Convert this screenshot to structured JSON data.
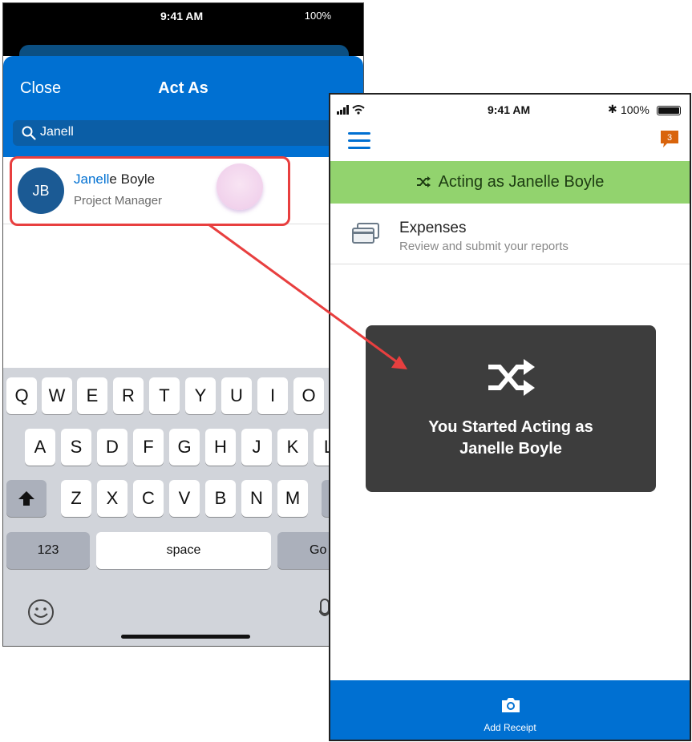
{
  "left_phone": {
    "status": {
      "time": "9:41 AM",
      "battery": "100%"
    },
    "header": {
      "close_label": "Close",
      "title": "Act As"
    },
    "search": {
      "query": "Janell"
    },
    "result": {
      "initials": "JB",
      "name_match": "Janell",
      "name_rest": "e Boyle",
      "role": "Project Manager"
    },
    "keyboard": {
      "row1": [
        "Q",
        "W",
        "E",
        "R",
        "T",
        "Y",
        "U",
        "I",
        "O"
      ],
      "row2": [
        "A",
        "S",
        "D",
        "F",
        "G",
        "H",
        "J",
        "K",
        "L"
      ],
      "row3": [
        "Z",
        "X",
        "C",
        "V",
        "B",
        "N",
        "M"
      ],
      "numbers_key": "123",
      "space_key": "space",
      "go_key": "Go"
    }
  },
  "right_phone": {
    "status": {
      "time": "9:41 AM",
      "battery": "100%"
    },
    "notification_count": "3",
    "banner": {
      "text": "Acting as Janelle Boyle"
    },
    "expenses": {
      "title": "Expenses",
      "subtitle": "Review and submit your reports"
    },
    "toast": {
      "line1": "You Started Acting as",
      "line2": "Janelle Boyle"
    },
    "bottom_bar": {
      "label": "Add Receipt"
    }
  },
  "colors": {
    "brand_blue": "#0070d2",
    "banner_green": "#92d36e",
    "highlight_red": "#e83f3f",
    "toast_bg": "#3d3d3d",
    "notification_orange": "#d9640c"
  }
}
